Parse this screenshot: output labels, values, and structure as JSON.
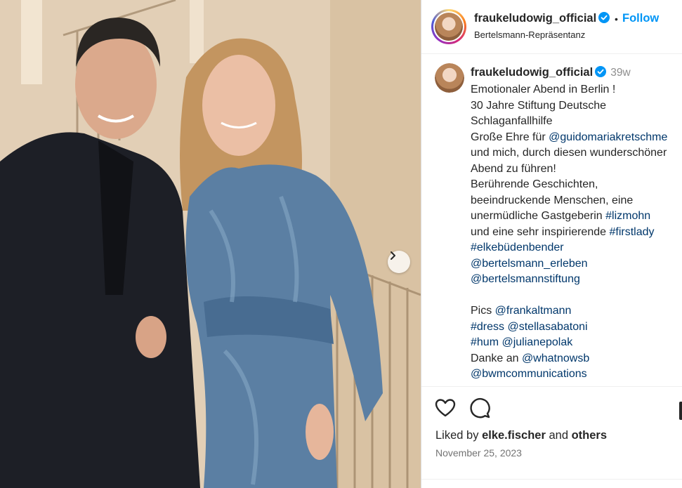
{
  "header": {
    "username": "fraukeludowig_official",
    "separator": "•",
    "follow_label": "Follow",
    "location": "Bertelsmann-Repräsentanz"
  },
  "caption": {
    "username": "fraukeludowig_official",
    "time": "39w",
    "lines": [
      [
        {
          "t": "Emotionaler Abend in Berlin !"
        }
      ],
      [
        {
          "t": "30 Jahre Stiftung Deutsche"
        }
      ],
      [
        {
          "t": "Schlaganfallhilfe"
        }
      ],
      [
        {
          "t": "Große Ehre für "
        },
        {
          "t": "@guidomariakretschme",
          "link": true
        }
      ],
      [
        {
          "t": "und mich, durch diesen wunderschöner"
        }
      ],
      [
        {
          "t": "Abend zu führen!"
        }
      ],
      [
        {
          "t": "Berührende Geschichten,"
        }
      ],
      [
        {
          "t": "beeindruckende Menschen, eine"
        }
      ],
      [
        {
          "t": "unermüdliche Gastgeberin "
        },
        {
          "t": "#lizmohn",
          "link": true
        }
      ],
      [
        {
          "t": "und eine sehr inspirierende "
        },
        {
          "t": "#firstlady",
          "link": true
        }
      ],
      [
        {
          "t": "#elkebüdenbender",
          "link": true
        }
      ],
      [
        {
          "t": "@bertelsmann_erleben",
          "link": true
        }
      ],
      [
        {
          "t": "@bertelsmannstiftung",
          "link": true
        }
      ],
      [
        {
          "t": ""
        }
      ],
      [
        {
          "t": "Pics "
        },
        {
          "t": "@frankaltmann",
          "link": true
        }
      ],
      [
        {
          "t": "#dress",
          "link": true
        },
        {
          "t": " "
        },
        {
          "t": "@stellasabatoni",
          "link": true
        }
      ],
      [
        {
          "t": "#hum",
          "link": true
        },
        {
          "t": " "
        },
        {
          "t": "@julianepolak",
          "link": true
        }
      ],
      [
        {
          "t": "Danke an "
        },
        {
          "t": "@whatnowsb",
          "link": true
        }
      ],
      [
        {
          "t": "@bwmcommunications",
          "link": true
        }
      ]
    ]
  },
  "likes": {
    "prefix": "Liked by",
    "user": "elke.fischer",
    "and": "and",
    "others": "others"
  },
  "date": "November 25, 2023",
  "icons": {
    "like": "heart-icon",
    "comment": "comment-icon",
    "carousel_next": "chevron-right-icon",
    "verified": "verified-badge-icon"
  },
  "colors": {
    "accent": "#0095f6",
    "link": "#00376b",
    "verified": "#0095f6",
    "muted": "#8e8e8e"
  }
}
